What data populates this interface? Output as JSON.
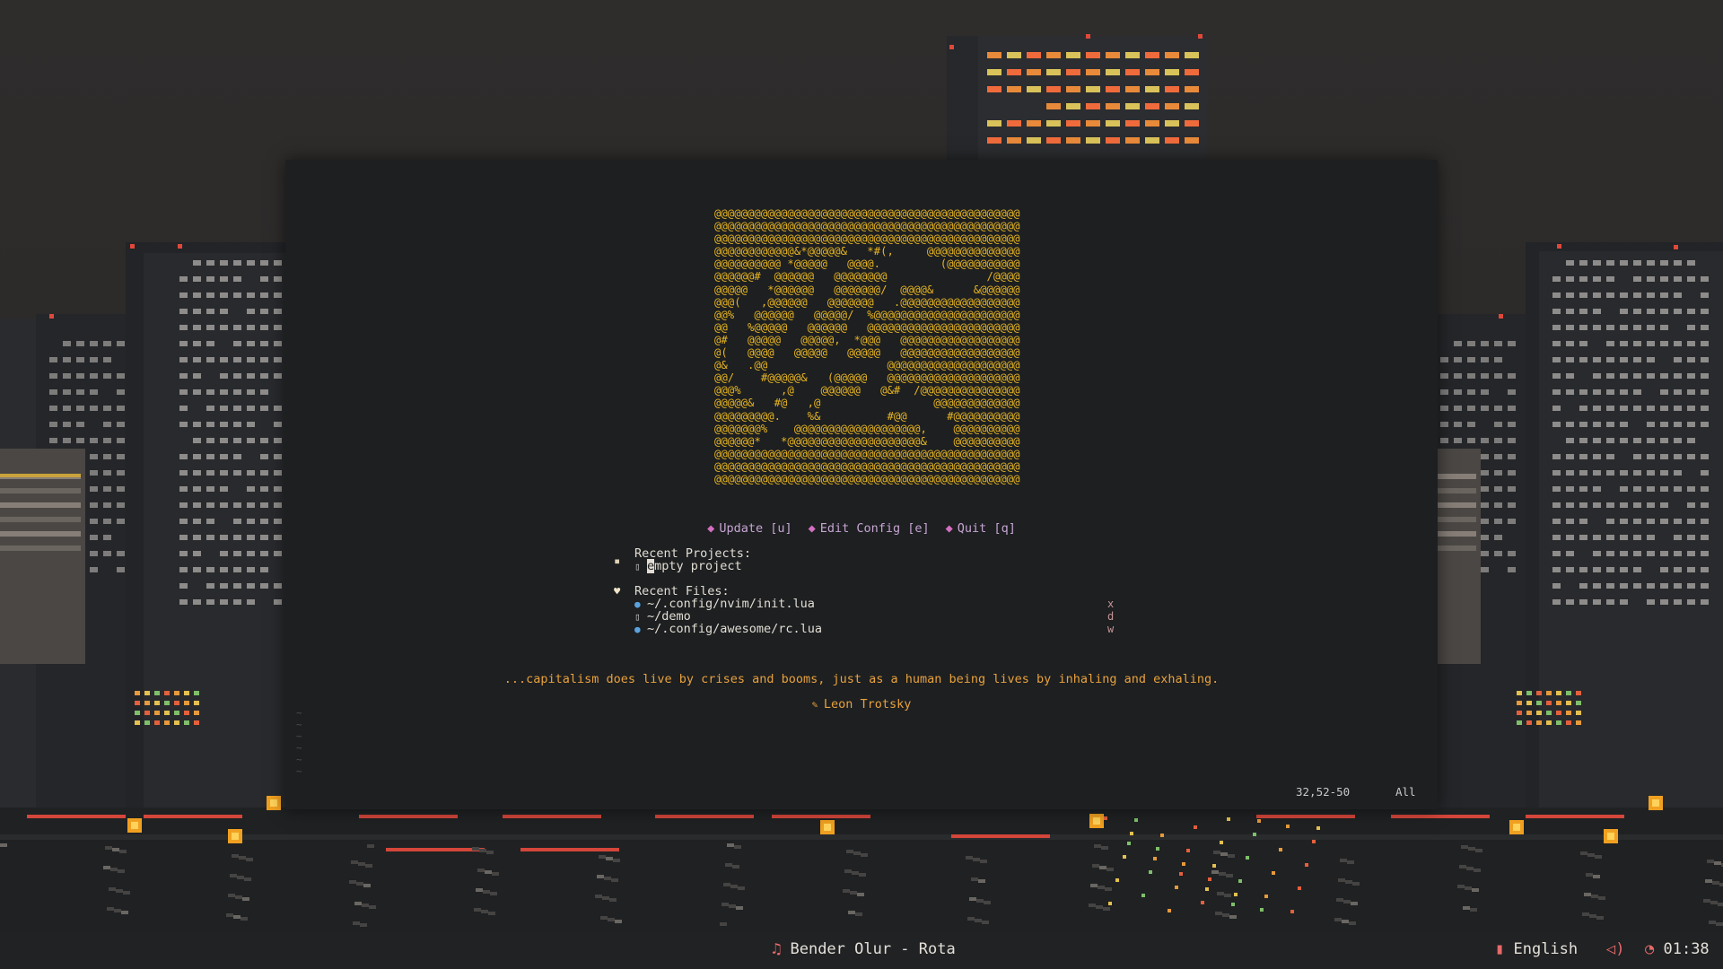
{
  "terminal": {
    "ascii_art": [
      "@@@@@@@@@@@@@@@@@@@@@@@@@@@@@@@@@@@@@@@@@@@@@@",
      "@@@@@@@@@@@@@@@@@@@@@@@@@@@@@@@@@@@@@@@@@@@@@@",
      "@@@@@@@@@@@@@@@@@@@@@@@@@@@@@@@@@@@@@@@@@@@@@@",
      "@@@@@@@@@@@@&*@@@@@&   *#(,     @@@@@@@@@@@@@@",
      "@@@@@@@@@@ *@@@@@   @@@@.         (@@@@@@@@@@@",
      "@@@@@@#  @@@@@@   @@@@@@@@               /@@@@",
      "@@@@@   *@@@@@@   @@@@@@@/  @@@@&      &@@@@@@",
      "@@@(   ,@@@@@@   @@@@@@@   .@@@@@@@@@@@@@@@@@@",
      "@@%   @@@@@@   @@@@@/  %@@@@@@@@@@@@@@@@@@@@@@",
      "@@   %@@@@@   @@@@@@   @@@@@@@@@@@@@@@@@@@@@@@",
      "@#   @@@@@   @@@@@,  *@@@   @@@@@@@@@@@@@@@@@@",
      "@(   @@@@   @@@@@   @@@@@   @@@@@@@@@@@@@@@@@@",
      "@&   .@@                  @@@@@@@@@@@@@@@@@@@@",
      "@@/    #@@@@@&   (@@@@@   @@@@@@@@@@@@@@@@@@@@",
      "@@@%      ,@    @@@@@@   @&#  /@@@@@@@@@@@@@@@",
      "@@@@@&   #@   ,@                 @@@@@@@@@@@@@",
      "@@@@@@@@@.    %&          #@@      #@@@@@@@@@@",
      "@@@@@@@%    @@@@@@@@@@@@@@@@@@@,    @@@@@@@@@@",
      "@@@@@@*   *@@@@@@@@@@@@@@@@@@@@&    @@@@@@@@@@",
      "@@@@@@@@@@@@@@@@@@@@@@@@@@@@@@@@@@@@@@@@@@@@@@",
      "@@@@@@@@@@@@@@@@@@@@@@@@@@@@@@@@@@@@@@@@@@@@@@",
      "@@@@@@@@@@@@@@@@@@@@@@@@@@@@@@@@@@@@@@@@@@@@@@"
    ],
    "menu": [
      {
        "label": "Update [u]"
      },
      {
        "label": "Edit Config [e]"
      },
      {
        "label": "Quit [q]"
      }
    ],
    "recent_projects": {
      "title": "Recent Projects:",
      "items": [
        {
          "cursor_char": "e",
          "rest": "mpty project"
        }
      ]
    },
    "recent_files": {
      "title": "Recent Files:",
      "items": [
        {
          "path": "~/.config/nvim/init.lua",
          "hotkey": "x",
          "icon": "lua-icon"
        },
        {
          "path": "~/demo",
          "hotkey": "d",
          "icon": "file-icon"
        },
        {
          "path": "~/.config/awesome/rc.lua",
          "hotkey": "w",
          "icon": "lua-icon"
        }
      ]
    },
    "quote": "...capitalism does live by crises and booms, just as a human being lives by inhaling and exhaling.",
    "author": "Leon Trotsky",
    "tilde_lines": [
      "~",
      "~",
      "~",
      "~",
      "~",
      "~"
    ],
    "status": {
      "position": "32,52-50",
      "scroll": "All"
    }
  },
  "bottombar": {
    "now_playing": "Bender Olur - Rota",
    "keyboard_layout": "English",
    "clock": "01:38"
  },
  "colors": {
    "accent": "#e86a6a",
    "ascii": "#e6b422",
    "quote": "#e8a13d",
    "menu": "#c6a4d2"
  }
}
